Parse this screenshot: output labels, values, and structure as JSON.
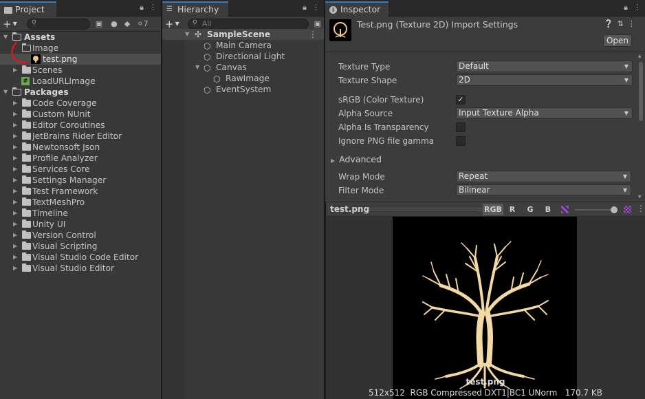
{
  "project": {
    "tab_label": "Project",
    "hidden_count": "7",
    "search_placeholder": "",
    "items": [
      {
        "label": "Assets",
        "bold": true
      },
      {
        "label": "Image"
      },
      {
        "label": "test.png"
      },
      {
        "label": "Scenes"
      },
      {
        "label": "LoadURLImage"
      },
      {
        "label": "Packages",
        "bold": true
      },
      {
        "label": "Code Coverage"
      },
      {
        "label": "Custom NUnit"
      },
      {
        "label": "Editor Coroutines"
      },
      {
        "label": "JetBrains Rider Editor"
      },
      {
        "label": "Newtonsoft Json"
      },
      {
        "label": "Profile Analyzer"
      },
      {
        "label": "Services Core"
      },
      {
        "label": "Settings Manager"
      },
      {
        "label": "Test Framework"
      },
      {
        "label": "TextMeshPro"
      },
      {
        "label": "Timeline"
      },
      {
        "label": "Unity UI"
      },
      {
        "label": "Version Control"
      },
      {
        "label": "Visual Scripting"
      },
      {
        "label": "Visual Studio Code Editor"
      },
      {
        "label": "Visual Studio Editor"
      }
    ]
  },
  "hierarchy": {
    "tab_label": "Hierarchy",
    "search_placeholder": "All",
    "items": [
      {
        "label": "SampleScene"
      },
      {
        "label": "Main Camera"
      },
      {
        "label": "Directional Light"
      },
      {
        "label": "Canvas"
      },
      {
        "label": "RawImage"
      },
      {
        "label": "EventSystem"
      }
    ]
  },
  "inspector": {
    "tab_label": "Inspector",
    "title": "Test.png (Texture 2D) Import Settings",
    "open_button": "Open",
    "properties": {
      "texture_type": {
        "label": "Texture Type",
        "value": "Default"
      },
      "texture_shape": {
        "label": "Texture Shape",
        "value": "2D"
      },
      "srgb": {
        "label": "sRGB (Color Texture)",
        "checked": true
      },
      "alpha_source": {
        "label": "Alpha Source",
        "value": "Input Texture Alpha"
      },
      "alpha_is_transparency": {
        "label": "Alpha Is Transparency",
        "checked": false
      },
      "ignore_png_gamma": {
        "label": "Ignore PNG file gamma",
        "checked": false
      },
      "advanced": {
        "label": "Advanced"
      },
      "wrap_mode": {
        "label": "Wrap Mode",
        "value": "Repeat"
      },
      "filter_mode": {
        "label": "Filter Mode",
        "value": "Bilinear"
      }
    },
    "check_glyph": "✓"
  },
  "preview": {
    "title": "test.png",
    "channels": [
      "RGB",
      "R",
      "G",
      "B"
    ],
    "image_name": "test.png",
    "info": "512x512  RGB Compressed DXT1|BC1 UNorm   170.7 KB",
    "image_bg": "#000000",
    "tree_color": "#f2d9a6"
  },
  "colors": {
    "panel_bg": "#383838",
    "selection_bg": "#4d4d4d",
    "tab_accent": "#3a79bb",
    "annotation_red": "#e0141e"
  }
}
